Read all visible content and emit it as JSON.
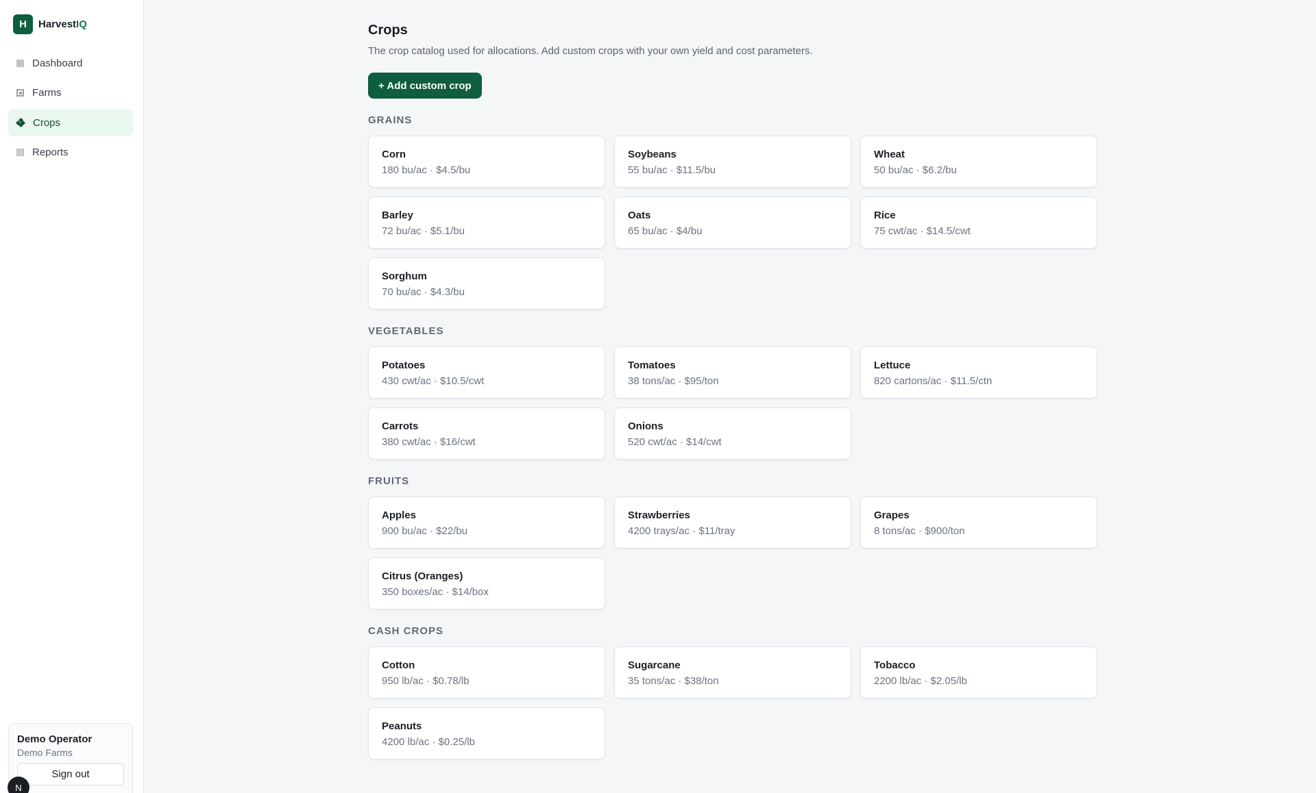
{
  "brand": {
    "logo_letter": "H",
    "name_prefix": "Harvest",
    "name_suffix": "IQ"
  },
  "nav": [
    {
      "label": "Dashboard",
      "icon": "dashboard-icon",
      "active": false
    },
    {
      "label": "Farms",
      "icon": "farm-icon",
      "active": false
    },
    {
      "label": "Crops",
      "icon": "crop-icon",
      "active": true
    },
    {
      "label": "Reports",
      "icon": "report-icon",
      "active": false
    }
  ],
  "user": {
    "name": "Demo Operator",
    "org": "Demo Farms",
    "signout_label": "Sign out",
    "badge": "N"
  },
  "page": {
    "title": "Crops",
    "description": "The crop catalog used for allocations. Add custom crops with your own yield and cost parameters.",
    "add_button": "+ Add custom crop"
  },
  "sections": [
    {
      "title": "GRAINS",
      "crops": [
        {
          "name": "Corn",
          "meta": "180 bu/ac · $4.5/bu"
        },
        {
          "name": "Soybeans",
          "meta": "55 bu/ac · $11.5/bu"
        },
        {
          "name": "Wheat",
          "meta": "50 bu/ac · $6.2/bu"
        },
        {
          "name": "Barley",
          "meta": "72 bu/ac · $5.1/bu"
        },
        {
          "name": "Oats",
          "meta": "65 bu/ac · $4/bu"
        },
        {
          "name": "Rice",
          "meta": "75 cwt/ac · $14.5/cwt"
        },
        {
          "name": "Sorghum",
          "meta": "70 bu/ac · $4.3/bu"
        }
      ]
    },
    {
      "title": "VEGETABLES",
      "crops": [
        {
          "name": "Potatoes",
          "meta": "430 cwt/ac · $10.5/cwt"
        },
        {
          "name": "Tomatoes",
          "meta": "38 tons/ac · $95/ton"
        },
        {
          "name": "Lettuce",
          "meta": "820 cartons/ac · $11.5/ctn"
        },
        {
          "name": "Carrots",
          "meta": "380 cwt/ac · $16/cwt"
        },
        {
          "name": "Onions",
          "meta": "520 cwt/ac · $14/cwt"
        }
      ]
    },
    {
      "title": "FRUITS",
      "crops": [
        {
          "name": "Apples",
          "meta": "900 bu/ac · $22/bu"
        },
        {
          "name": "Strawberries",
          "meta": "4200 trays/ac · $11/tray"
        },
        {
          "name": "Grapes",
          "meta": "8 tons/ac · $900/ton"
        },
        {
          "name": "Citrus (Oranges)",
          "meta": "350 boxes/ac · $14/box"
        }
      ]
    },
    {
      "title": "CASH CROPS",
      "crops": [
        {
          "name": "Cotton",
          "meta": "950 lb/ac · $0.78/lb"
        },
        {
          "name": "Sugarcane",
          "meta": "35 tons/ac · $38/ton"
        },
        {
          "name": "Tobacco",
          "meta": "2200 lb/ac · $2.05/lb"
        },
        {
          "name": "Peanuts",
          "meta": "4200 lb/ac · $0.25/lb"
        }
      ]
    }
  ],
  "colors": {
    "brand": "#0f5e3f",
    "active_nav_bg": "#e9f7ef",
    "background": "#f5f6f8"
  }
}
